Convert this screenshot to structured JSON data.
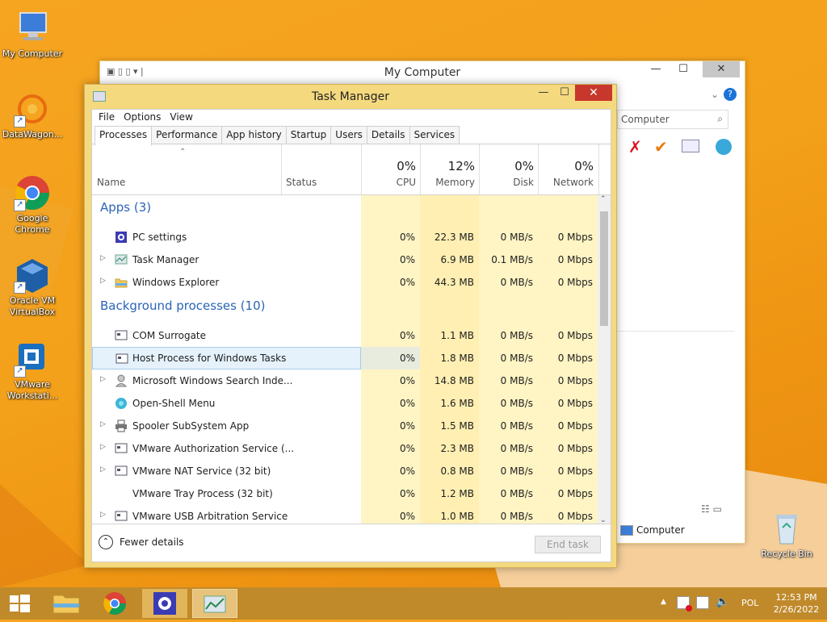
{
  "desktop": {
    "icons": [
      {
        "label1": "My Computer",
        "label2": ""
      },
      {
        "label1": "DataWagon...",
        "label2": ""
      },
      {
        "label1": "Google",
        "label2": "Chrome"
      },
      {
        "label1": "Oracle VM",
        "label2": "VirtualBox"
      },
      {
        "label1": "VMware",
        "label2": "Workstati..."
      },
      {
        "label1": "Recycle Bin",
        "label2": ""
      }
    ]
  },
  "mycomputer": {
    "title": "My Computer",
    "search_text": "Computer",
    "status_item": "Computer"
  },
  "taskmanager": {
    "title": "Task Manager",
    "menu": [
      "File",
      "Options",
      "View"
    ],
    "tabs": [
      "Processes",
      "Performance",
      "App history",
      "Startup",
      "Users",
      "Details",
      "Services"
    ],
    "columns": {
      "name": "Name",
      "status": "Status",
      "cpu": {
        "pct": "0%",
        "label": "CPU"
      },
      "memory": {
        "pct": "12%",
        "label": "Memory"
      },
      "disk": {
        "pct": "0%",
        "label": "Disk"
      },
      "network": {
        "pct": "0%",
        "label": "Network"
      }
    },
    "groups": {
      "apps": "Apps (3)",
      "background": "Background processes (10)"
    },
    "apps": [
      {
        "name": "PC settings",
        "cpu": "0%",
        "mem": "22.3 MB",
        "disk": "0 MB/s",
        "net": "0 Mbps",
        "icon": "gear-icon"
      },
      {
        "name": "Task Manager",
        "cpu": "0%",
        "mem": "6.9 MB",
        "disk": "0.1 MB/s",
        "net": "0 Mbps",
        "icon": "task-manager-icon"
      },
      {
        "name": "Windows Explorer",
        "cpu": "0%",
        "mem": "44.3 MB",
        "disk": "0 MB/s",
        "net": "0 Mbps",
        "icon": "folder-icon"
      }
    ],
    "background": [
      {
        "name": "COM Surrogate",
        "cpu": "0%",
        "mem": "1.1 MB",
        "disk": "0 MB/s",
        "net": "0 Mbps"
      },
      {
        "name": "Host Process for Windows Tasks",
        "cpu": "0%",
        "mem": "1.8 MB",
        "disk": "0 MB/s",
        "net": "0 Mbps"
      },
      {
        "name": "Microsoft Windows Search Inde...",
        "cpu": "0%",
        "mem": "14.8 MB",
        "disk": "0 MB/s",
        "net": "0 Mbps"
      },
      {
        "name": "Open-Shell Menu",
        "cpu": "0%",
        "mem": "1.6 MB",
        "disk": "0 MB/s",
        "net": "0 Mbps"
      },
      {
        "name": "Spooler SubSystem App",
        "cpu": "0%",
        "mem": "1.5 MB",
        "disk": "0 MB/s",
        "net": "0 Mbps"
      },
      {
        "name": "VMware Authorization Service (...",
        "cpu": "0%",
        "mem": "2.3 MB",
        "disk": "0 MB/s",
        "net": "0 Mbps"
      },
      {
        "name": "VMware NAT Service (32 bit)",
        "cpu": "0%",
        "mem": "0.8 MB",
        "disk": "0 MB/s",
        "net": "0 Mbps"
      },
      {
        "name": "VMware Tray Process (32 bit)",
        "cpu": "0%",
        "mem": "1.2 MB",
        "disk": "0 MB/s",
        "net": "0 Mbps"
      },
      {
        "name": "VMware USB Arbitration Service",
        "cpu": "0%",
        "mem": "1.0 MB",
        "disk": "0 MB/s",
        "net": "0 Mbps"
      }
    ],
    "footer": {
      "fewer": "Fewer details",
      "end_task": "End task"
    }
  },
  "taskbar": {
    "lang": "POL",
    "time": "12:53 PM",
    "date": "2/26/2022"
  }
}
